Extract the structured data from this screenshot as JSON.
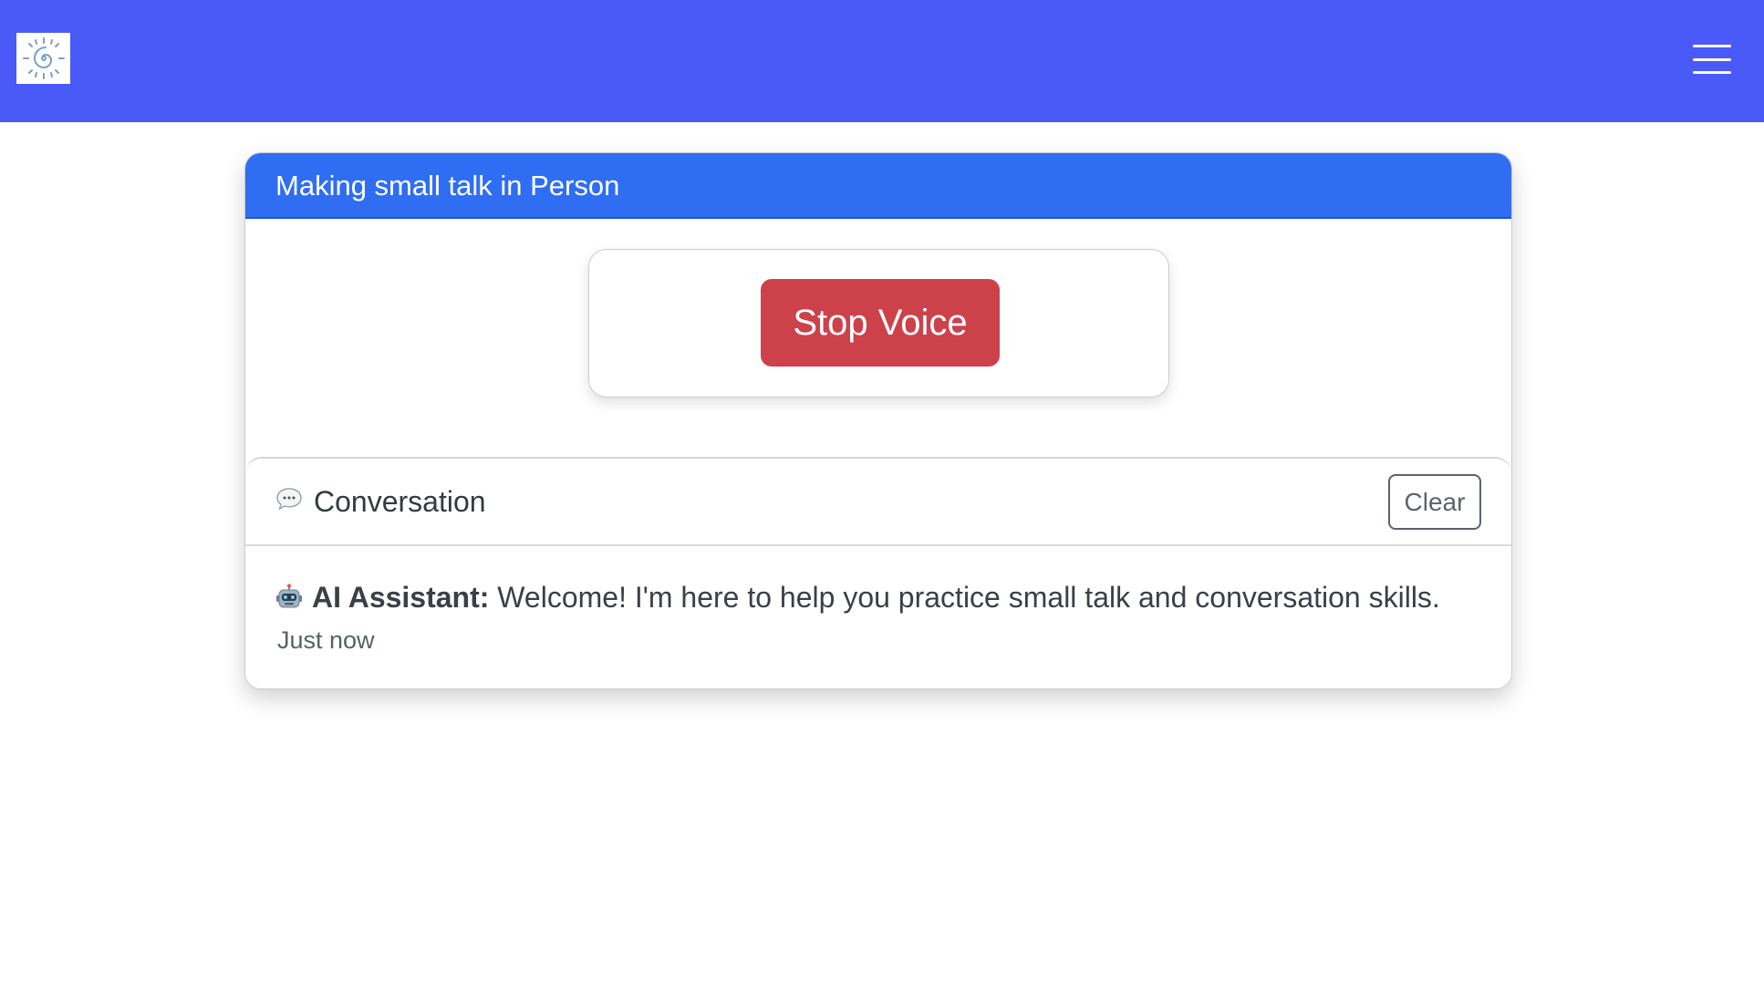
{
  "navbar": {
    "logo_icon": "spiral-sun-icon",
    "menu_icon": "hamburger-menu-icon",
    "background_color": "#4a5af8"
  },
  "card": {
    "title": "Making small talk in Person",
    "header_color": "#2f6ef3"
  },
  "voice": {
    "stop_label": "Stop Voice",
    "button_color": "#cd414b"
  },
  "conversation": {
    "icon": "speech-bubble-icon",
    "title": "Conversation",
    "clear_label": "Clear",
    "messages": [
      {
        "icon": "robot-icon",
        "sender": "AI Assistant:",
        "text": "Welcome! I'm here to help you practice small talk and conversation skills.",
        "time": "Just now"
      }
    ]
  }
}
